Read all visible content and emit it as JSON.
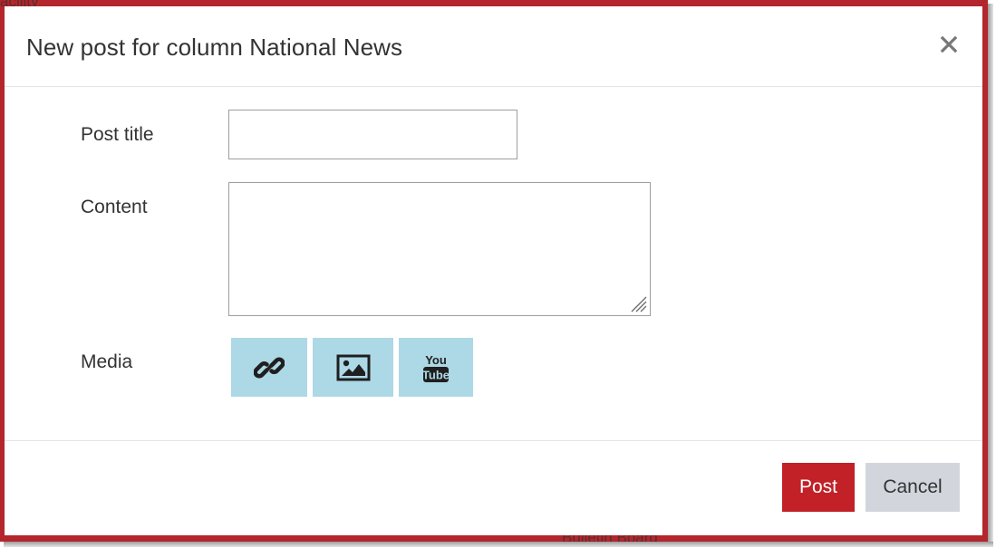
{
  "backdrop": {
    "partial_text_top": "acility",
    "partial_text_bottom": "Bulletin Board",
    "color": "#b3262c"
  },
  "modal": {
    "title": "New post for column National News",
    "close_icon": "close-icon",
    "close_glyph": "×"
  },
  "form": {
    "post_title_label": "Post title",
    "post_title_value": "",
    "content_label": "Content",
    "content_value": "",
    "media_label": "Media",
    "media_buttons": [
      {
        "icon": "link-icon"
      },
      {
        "icon": "image-icon"
      },
      {
        "icon": "youtube-icon",
        "text_top": "You",
        "text_bottom": "Tube"
      }
    ],
    "media_button_color": "#add8e6"
  },
  "footer": {
    "post_label": "Post",
    "cancel_label": "Cancel",
    "post_color": "#c12127",
    "cancel_color": "#d2d6dc"
  }
}
